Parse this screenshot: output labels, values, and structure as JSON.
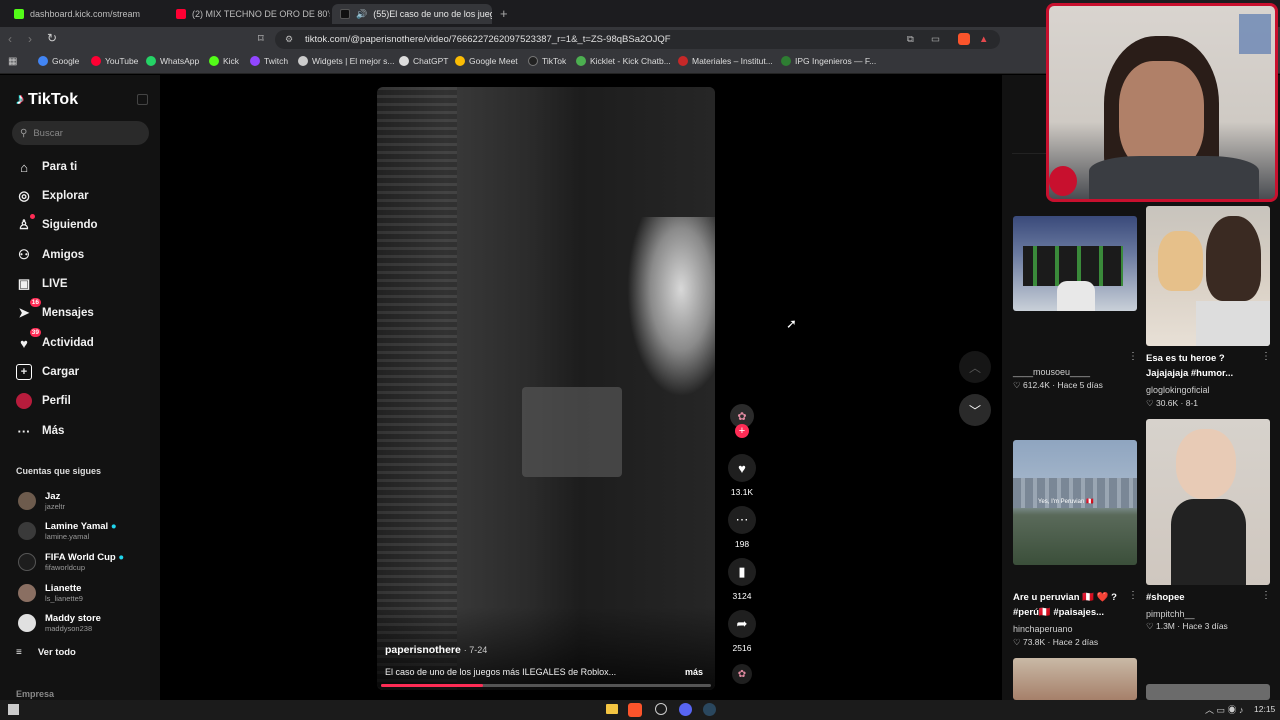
{
  "browser": {
    "tabs": [
      {
        "label": "dashboard.kick.com/stream",
        "color": "#53fc18"
      },
      {
        "label": "(2) MIX TECHNO DE ORO DE 80's &",
        "color": "#ff0033"
      },
      {
        "label": "(55)El caso de uno de los jueg",
        "color": "#111111"
      }
    ],
    "new_tab": "+",
    "url": "tiktok.com/@paperisnothere/video/7666227262097523387_r=1&_t=ZS-98qBSa2OJQF"
  },
  "bookmarks": [
    {
      "label": "Google",
      "color": "#4285f4"
    },
    {
      "label": "YouTube",
      "color": "#ff0033"
    },
    {
      "label": "WhatsApp",
      "color": "#25d366"
    },
    {
      "label": "Kick",
      "color": "#53fc18"
    },
    {
      "label": "Twitch",
      "color": "#9146ff"
    },
    {
      "label": "Widgets | El mejor s...",
      "color": "#cccccc"
    },
    {
      "label": "ChatGPT",
      "color": "#dddddd"
    },
    {
      "label": "Google Meet",
      "color": "#fbbc04"
    },
    {
      "label": "TikTok",
      "color": "#222222"
    },
    {
      "label": "Kicklet - Kick Chatb...",
      "color": "#4caf50"
    },
    {
      "label": "Materiales – Institut...",
      "color": "#c62828"
    },
    {
      "label": "IPG Ingenieros — F...",
      "color": "#2e7d32"
    }
  ],
  "sidebar": {
    "logo": "TikTok",
    "search_placeholder": "Buscar",
    "nav": [
      {
        "label": "Para ti",
        "icon": "home-icon"
      },
      {
        "label": "Explorar",
        "icon": "compass-icon"
      },
      {
        "label": "Siguiendo",
        "icon": "following-icon"
      },
      {
        "label": "Amigos",
        "icon": "friends-icon"
      },
      {
        "label": "LIVE",
        "icon": "live-icon"
      },
      {
        "label": "Mensajes",
        "icon": "messages-icon",
        "badge": "16"
      },
      {
        "label": "Actividad",
        "icon": "activity-icon",
        "badge": "39"
      },
      {
        "label": "Cargar",
        "icon": "upload-icon"
      },
      {
        "label": "Perfil",
        "icon": "profile-icon"
      },
      {
        "label": "Más",
        "icon": "more-icon"
      }
    ],
    "following_title": "Cuentas que sigues",
    "following": [
      {
        "name": "Jaz",
        "user": "jazeltr"
      },
      {
        "name": "Lamine Yamal",
        "user": "lamine.yamal"
      },
      {
        "name": "FIFA World Cup",
        "user": "fifaworldcup"
      },
      {
        "name": "Lianette",
        "user": "ls_lianette9"
      },
      {
        "name": "Maddy store",
        "user": "maddyson238"
      }
    ],
    "see_all": "Ver todo",
    "footer": "Empresa"
  },
  "video": {
    "author": "paperisnothere",
    "date": "7-24",
    "caption": "El caso de uno de los juegos más ILEGALES de Roblox...",
    "more": "más",
    "progress": 0.31,
    "likes": "13.1K",
    "comments": "198",
    "saves": "3124",
    "shares": "2516"
  },
  "recommendations": [
    {
      "title": "",
      "author": "____mousoeu____",
      "stats": "612.4K · Hace 5 días"
    },
    {
      "title": "Esa es tu heroe ? Jajajajaja #humor...",
      "author": "gloglokingoficial",
      "stats": "30.6K · 8-1"
    },
    {
      "title": "Are u peruvian 🇵🇪 ❤️ ? #perú🇵🇪 #paisajes...",
      "author": "hinchaperuano",
      "stats": "73.8K · Hace 2 días"
    },
    {
      "title": "#shopee",
      "author": "pimpitchh__",
      "stats": "1.3M · Hace 3 días"
    }
  ],
  "thumb_overlay": "Yes, I'm Peruvian 🇵🇪",
  "taskbar": {
    "time": "12:15"
  }
}
